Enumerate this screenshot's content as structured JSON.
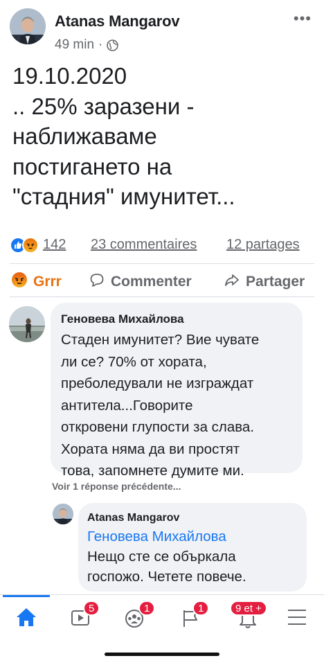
{
  "post": {
    "author": "Atanas Mangarov",
    "time": "49 min",
    "separator": "·",
    "more": "•••",
    "text_lines": [
      "19.10.2020",
      ".. 25% заразени -",
      "наближаваме",
      "постигането на",
      "\"стадния\" имунитет..."
    ]
  },
  "reactions": {
    "count": "142",
    "comments": "23 commentaires",
    "shares": "12 partages"
  },
  "actions": {
    "reaction": "Grrr",
    "comment": "Commenter",
    "share": "Partager"
  },
  "comment": {
    "author": "Геновева Михайлова",
    "lines": [
      "Стаден имунитет? Вие чувате",
      "ли се? 70% от хората,",
      "преболедували не изграждат",
      "антитела...Говорите",
      "откровени глупости за слава.",
      "Хората няма да ви простят",
      "това, запомнете думите ми."
    ]
  },
  "view_replies": "Voir 1 réponse précédente...",
  "reply": {
    "author": "Atanas Mangarov",
    "mention": "Геновева Михайлова",
    "lines": [
      "Нещо сте се объркала",
      "госпожо. Четете повече."
    ]
  },
  "tabbar": {
    "watch_badge": "5",
    "groups_badge": "1",
    "pages_badge": "1",
    "notifications_badge": "9 et +"
  },
  "colors": {
    "accent": "#1877f2",
    "angry": "#e9710f",
    "badge": "#e41e3f",
    "bubble": "#f0f2f5",
    "muted": "#65676b"
  },
  "icons": {
    "privacy": "globe-icon",
    "comment": "speech-bubble-icon",
    "share": "share-arrow-icon",
    "reaction": "angry-face-icon"
  }
}
